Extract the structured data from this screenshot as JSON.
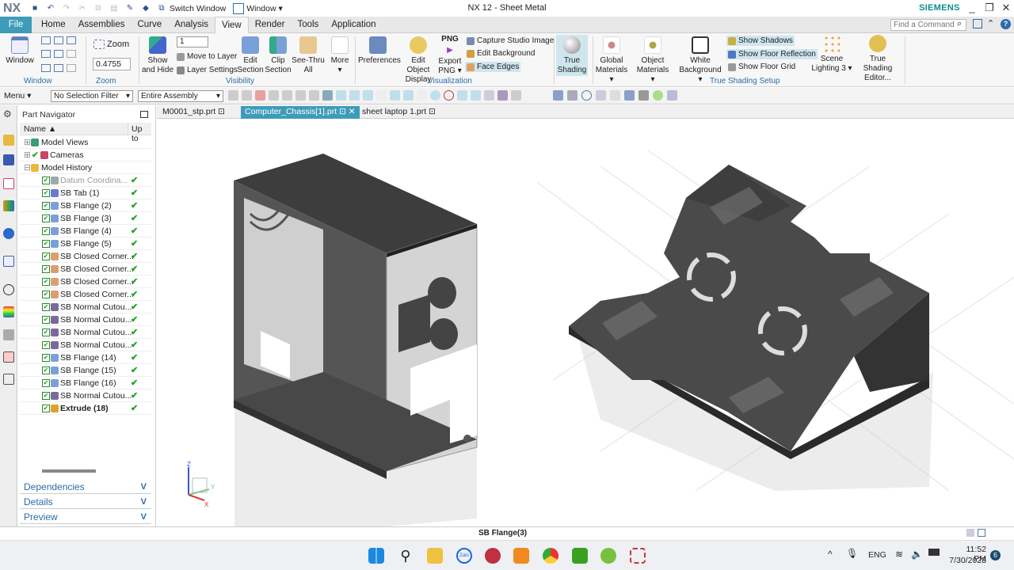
{
  "titlebar": {
    "logo": "NX",
    "title": "NX 12 - Sheet Metal",
    "brand": "SIEMENS",
    "switch_window": "Switch Window",
    "window_menu": "Window ▾",
    "minimize": "_",
    "restore": "❐",
    "close": "✕"
  },
  "menu_tabs": [
    "File",
    "Home",
    "Assemblies",
    "Curve",
    "Analysis",
    "View",
    "Render",
    "Tools",
    "Application"
  ],
  "active_tab": "View",
  "find_command": {
    "placeholder": "Find a Command"
  },
  "ribbon": {
    "window": {
      "button": "Window",
      "group": "Window"
    },
    "zoom": {
      "button": "Zoom",
      "value": "0.4755",
      "group": "Zoom"
    },
    "visibility": {
      "layer_value": "1",
      "show_and_hide": [
        "Show",
        "and Hide"
      ],
      "move_to_layer": "Move to Layer",
      "layer_settings": "Layer Settings",
      "edit_section": [
        "Edit",
        "Section"
      ],
      "clip_section": [
        "Clip",
        "Section"
      ],
      "see_thru": [
        "See-Thru",
        "All"
      ],
      "more": "More",
      "group": "Visibility"
    },
    "visualization": {
      "preferences": "Preferences",
      "edit_object_display": [
        "Edit Object",
        "Display"
      ],
      "png_label": "PNG",
      "export_png": [
        "Export",
        "PNG ▾"
      ],
      "capture_studio_image": "Capture Studio Image",
      "edit_background": "Edit Background",
      "face_edges": "Face Edges",
      "group": "Visualization"
    },
    "true_shading": {
      "true_shading": [
        "True",
        "Shading"
      ],
      "global_materials": [
        "Global",
        "Materials ▾"
      ],
      "object_materials": [
        "Object",
        "Materials ▾"
      ],
      "white_background": [
        "White",
        "Background ▾"
      ],
      "show_shadows": "Show Shadows",
      "show_floor_reflection": "Show Floor Reflection",
      "show_floor_grid": "Show Floor Grid",
      "scene_lighting": [
        "Scene",
        "Lighting 3 ▾"
      ],
      "true_shading_editor": [
        "True Shading",
        "Editor..."
      ],
      "group": "True Shading Setup"
    }
  },
  "toolbar": {
    "menu": "Menu ▾",
    "selection_filter": "No Selection Filter",
    "scope": "Entire Assembly"
  },
  "navigator": {
    "title": "Part Navigator",
    "columns": [
      "Name ▲",
      "Up to"
    ],
    "top_nodes": [
      {
        "label": "Model Views"
      },
      {
        "label": "Cameras"
      },
      {
        "label": "Model History"
      }
    ],
    "items": [
      {
        "label": "Datum Coordina...",
        "color": "#9aa"
      },
      {
        "label": "SB Tab (1)",
        "color": "#6a7ad0"
      },
      {
        "label": "SB Flange (2)",
        "color": "#7aa0d8"
      },
      {
        "label": "SB Flange (3)",
        "color": "#7aa0d8"
      },
      {
        "label": "SB Flange (4)",
        "color": "#7aa0d8"
      },
      {
        "label": "SB Flange (5)",
        "color": "#7aa0d8"
      },
      {
        "label": "SB Closed Corner...",
        "color": "#d8a070"
      },
      {
        "label": "SB Closed Corner...",
        "color": "#d8a070"
      },
      {
        "label": "SB Closed Corner...",
        "color": "#d8a070"
      },
      {
        "label": "SB Closed Corner...",
        "color": "#d8a070"
      },
      {
        "label": "SB Normal Cutou...",
        "color": "#7a6a9a"
      },
      {
        "label": "SB Normal Cutou...",
        "color": "#7a6a9a"
      },
      {
        "label": "SB Normal Cutou...",
        "color": "#7a6a9a"
      },
      {
        "label": "SB Normal Cutou...",
        "color": "#7a6a9a"
      },
      {
        "label": "SB Flange (14)",
        "color": "#7aa0d8"
      },
      {
        "label": "SB Flange (15)",
        "color": "#7aa0d8"
      },
      {
        "label": "SB Flange (16)",
        "color": "#7aa0d8"
      },
      {
        "label": "SB Normal Cutou...",
        "color": "#7a6a9a"
      },
      {
        "label": "Extrude (18)",
        "color": "#e0a030"
      }
    ],
    "panels": [
      "Dependencies",
      "Details",
      "Preview"
    ]
  },
  "doc_tabs": [
    "M0001_stp.prt",
    "Computer_Chassis[1].prt",
    "sheet laptop 1.prt"
  ],
  "active_doc": 1,
  "triad": {
    "z": "Z",
    "y": "Y",
    "x": "X"
  },
  "status": "SB Flange(3)",
  "taskbar": {
    "lang": "ENG",
    "time": "11:52 PM",
    "date": "7/30/2023",
    "notifications": "6",
    "zalo": "Zalo"
  }
}
